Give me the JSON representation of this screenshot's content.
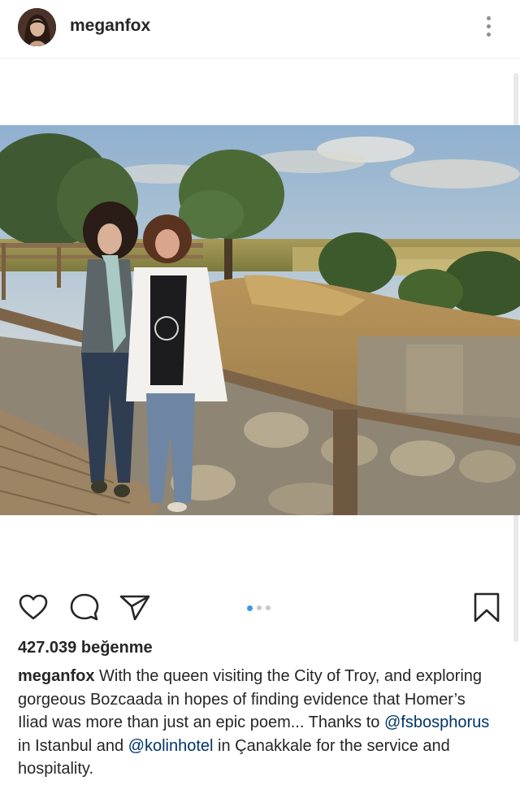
{
  "header": {
    "username": "meganfox",
    "more_icon": "more-vertical-icon"
  },
  "photo": {
    "description_icon": "post-photo"
  },
  "actions": {
    "like_icon": "heart-icon",
    "comment_icon": "comment-icon",
    "share_icon": "send-icon",
    "save_icon": "bookmark-icon",
    "carousel": {
      "total": 3,
      "active_index": 0
    }
  },
  "likes": {
    "text": "427.039 beğenme"
  },
  "caption": {
    "username": "meganfox",
    "text_part1": " With the queen visiting the City of Troy, and exploring gorgeous Bozcaada in hopes of finding evidence that Homer’s Iliad was more than just an epic poem... Thanks to ",
    "mention1": "@fsbosphorus",
    "text_part2": " in Istanbul and ",
    "mention2": "@kolinhotel",
    "text_part3": " in Çanakkale for the service and hospitality."
  },
  "colors": {
    "text": "#262626",
    "mention": "#003569",
    "carousel_active": "#3897f0",
    "carousel_inactive": "#c7c7c7"
  }
}
